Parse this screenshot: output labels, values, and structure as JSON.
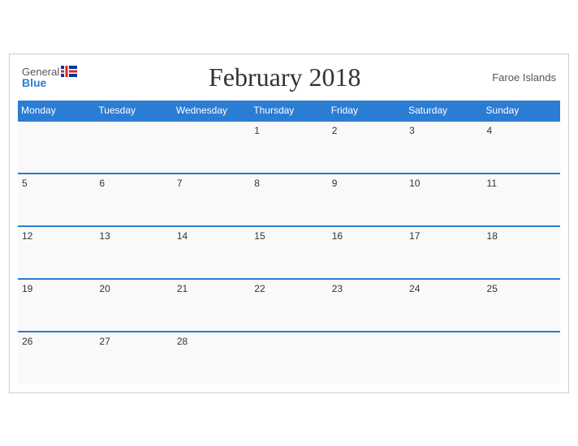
{
  "header": {
    "logo_general": "General",
    "logo_blue": "Blue",
    "title": "February 2018",
    "region": "Faroe Islands"
  },
  "weekdays": [
    "Monday",
    "Tuesday",
    "Wednesday",
    "Thursday",
    "Friday",
    "Saturday",
    "Sunday"
  ],
  "weeks": [
    [
      null,
      null,
      null,
      1,
      2,
      3,
      4
    ],
    [
      5,
      6,
      7,
      8,
      9,
      10,
      11
    ],
    [
      12,
      13,
      14,
      15,
      16,
      17,
      18
    ],
    [
      19,
      20,
      21,
      22,
      23,
      24,
      25
    ],
    [
      26,
      27,
      28,
      null,
      null,
      null,
      null
    ]
  ]
}
